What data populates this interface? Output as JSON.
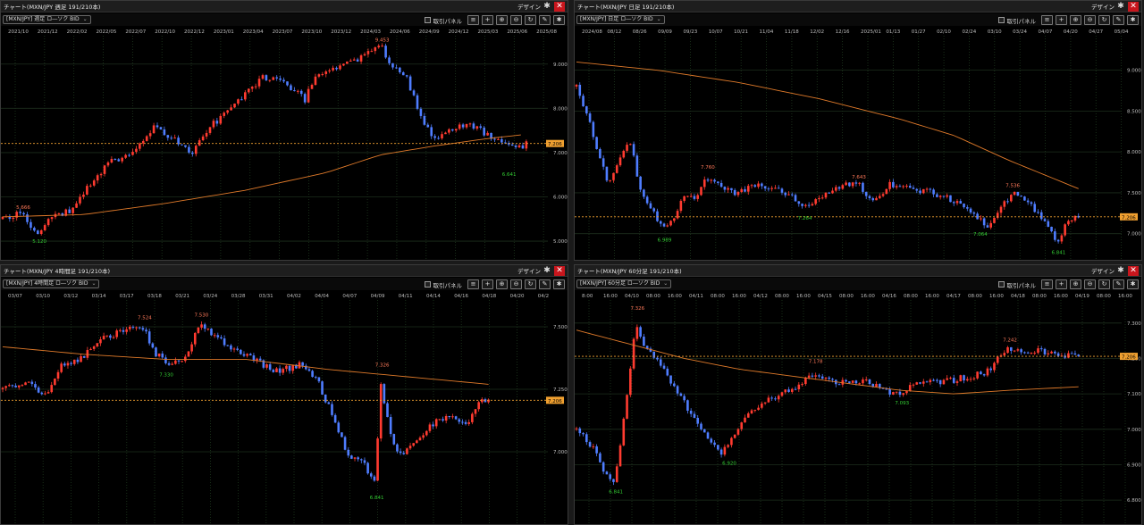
{
  "common": {
    "design_label": "デザイン",
    "close_glyph": "✕",
    "gear_glyph": "✱",
    "trade_panel_label": "取引パネル",
    "icons": [
      "menu-icon",
      "crosshair-icon",
      "zoom-in-icon",
      "zoom-out-icon",
      "refresh-icon",
      "draw-icon",
      "gear-icon"
    ],
    "icon_glyphs": [
      "≡",
      "+",
      "⊕",
      "⊖",
      "↻",
      "✎",
      "✱"
    ],
    "colors": {
      "up": "#ff3b30",
      "down": "#4f7dff",
      "ma": "#e07a2a",
      "current": "#f0a030",
      "high_label": "#ff7a5a",
      "low_label": "#33cc33",
      "grid": "#1f3a1f"
    }
  },
  "panels": [
    {
      "window_title": "チャート(MXN/JPY 週足 191/210本)",
      "symbol_select": "[MXN/JPY] 週足 ロ―ソク BID",
      "chart_data": {
        "type": "candlestick",
        "timeframe": "weekly",
        "x_tick_labels": [
          "2021/10",
          "2021/12",
          "2022/02",
          "2022/05",
          "2022/07",
          "2022/10",
          "2022/12",
          "2023/01",
          "2023/04",
          "2023/07",
          "2023/10",
          "2023/12",
          "2024/03",
          "2024/06",
          "2024/09",
          "2024/12",
          "2025/03",
          "2025/06",
          "2025/08"
        ],
        "y_tick_labels": [
          "9.000",
          "8.000",
          "7.000",
          "6.000",
          "5.000"
        ],
        "ylim": [
          4.8,
          9.6
        ],
        "current_price": "7.206",
        "annotations": [
          {
            "text": "5.666",
            "kind": "high",
            "x": 0.035,
            "y": 5.67
          },
          {
            "text": "5.120",
            "kind": "low",
            "x": 0.065,
            "y": 5.12
          },
          {
            "text": "9.453",
            "kind": "high",
            "x": 0.7,
            "y": 9.45
          },
          {
            "text": "6.641",
            "kind": "low",
            "x": 0.935,
            "y": 6.64
          }
        ],
        "path": [
          [
            0,
            5.5
          ],
          [
            0.035,
            5.66
          ],
          [
            0.065,
            5.15
          ],
          [
            0.09,
            5.55
          ],
          [
            0.13,
            5.72
          ],
          [
            0.16,
            6.25
          ],
          [
            0.2,
            6.8
          ],
          [
            0.24,
            7.0
          ],
          [
            0.28,
            7.55
          ],
          [
            0.31,
            7.35
          ],
          [
            0.35,
            7.0
          ],
          [
            0.38,
            7.55
          ],
          [
            0.42,
            7.95
          ],
          [
            0.45,
            8.35
          ],
          [
            0.48,
            8.7
          ],
          [
            0.52,
            8.6
          ],
          [
            0.56,
            8.2
          ],
          [
            0.58,
            8.75
          ],
          [
            0.62,
            8.9
          ],
          [
            0.66,
            9.1
          ],
          [
            0.7,
            9.45
          ],
          [
            0.72,
            8.9
          ],
          [
            0.745,
            8.8
          ],
          [
            0.76,
            8.3
          ],
          [
            0.775,
            7.8
          ],
          [
            0.8,
            7.3
          ],
          [
            0.83,
            7.55
          ],
          [
            0.87,
            7.6
          ],
          [
            0.9,
            7.4
          ],
          [
            0.93,
            7.25
          ],
          [
            0.95,
            7.05
          ],
          [
            0.97,
            7.2
          ]
        ],
        "ma": [
          [
            0,
            5.55
          ],
          [
            0.15,
            5.6
          ],
          [
            0.3,
            5.85
          ],
          [
            0.45,
            6.15
          ],
          [
            0.6,
            6.55
          ],
          [
            0.7,
            6.95
          ],
          [
            0.8,
            7.15
          ],
          [
            0.9,
            7.32
          ],
          [
            0.96,
            7.4
          ]
        ]
      }
    },
    {
      "window_title": "チャート(MXN/JPY 日足 191/210本)",
      "symbol_select": "[MXN/JPY] 日足 ロ―ソク BID",
      "chart_data": {
        "type": "candlestick",
        "timeframe": "daily",
        "x_tick_labels": [
          "2024/08",
          "08/12",
          "08/26",
          "09/09",
          "09/23",
          "10/07",
          "10/21",
          "11/04",
          "11/18",
          "12/02",
          "12/16",
          "2025/01",
          "01/13",
          "01/27",
          "02/10",
          "02/24",
          "03/10",
          "03/24",
          "04/07",
          "04/20",
          "04/27",
          "05/04"
        ],
        "y_tick_labels": [
          "9.000",
          "8.500",
          "8.000",
          "7.500",
          "7.000"
        ],
        "ylim": [
          6.8,
          9.4
        ],
        "current_price": "7.206",
        "annotations": [
          {
            "text": "7.760",
            "kind": "high",
            "x": 0.24,
            "y": 7.76
          },
          {
            "text": "6.989",
            "kind": "low",
            "x": 0.16,
            "y": 6.99
          },
          {
            "text": "7.643",
            "kind": "high",
            "x": 0.52,
            "y": 7.64
          },
          {
            "text": "7.264",
            "kind": "low",
            "x": 0.42,
            "y": 7.26
          },
          {
            "text": "7.536",
            "kind": "high",
            "x": 0.805,
            "y": 7.54
          },
          {
            "text": "7.064",
            "kind": "low",
            "x": 0.745,
            "y": 7.06
          },
          {
            "text": "6.841",
            "kind": "low",
            "x": 0.89,
            "y": 6.84
          }
        ],
        "path": [
          [
            0,
            8.8
          ],
          [
            0.02,
            8.45
          ],
          [
            0.04,
            8.0
          ],
          [
            0.06,
            7.6
          ],
          [
            0.08,
            7.95
          ],
          [
            0.1,
            8.1
          ],
          [
            0.12,
            7.5
          ],
          [
            0.14,
            7.3
          ],
          [
            0.16,
            7.05
          ],
          [
            0.18,
            7.2
          ],
          [
            0.2,
            7.5
          ],
          [
            0.22,
            7.4
          ],
          [
            0.24,
            7.7
          ],
          [
            0.27,
            7.55
          ],
          [
            0.3,
            7.5
          ],
          [
            0.33,
            7.6
          ],
          [
            0.36,
            7.55
          ],
          [
            0.39,
            7.5
          ],
          [
            0.42,
            7.3
          ],
          [
            0.45,
            7.45
          ],
          [
            0.48,
            7.55
          ],
          [
            0.5,
            7.6
          ],
          [
            0.52,
            7.62
          ],
          [
            0.55,
            7.4
          ],
          [
            0.58,
            7.6
          ],
          [
            0.62,
            7.55
          ],
          [
            0.66,
            7.5
          ],
          [
            0.7,
            7.4
          ],
          [
            0.73,
            7.25
          ],
          [
            0.76,
            7.1
          ],
          [
            0.79,
            7.35
          ],
          [
            0.81,
            7.5
          ],
          [
            0.84,
            7.35
          ],
          [
            0.87,
            7.1
          ],
          [
            0.89,
            6.9
          ],
          [
            0.91,
            7.15
          ],
          [
            0.93,
            7.2
          ]
        ],
        "ma": [
          [
            0,
            9.1
          ],
          [
            0.15,
            9.0
          ],
          [
            0.3,
            8.85
          ],
          [
            0.45,
            8.65
          ],
          [
            0.6,
            8.4
          ],
          [
            0.7,
            8.2
          ],
          [
            0.8,
            7.9
          ],
          [
            0.93,
            7.55
          ]
        ]
      }
    },
    {
      "window_title": "チャート(MXN/JPY 4時間足 191/210本)",
      "symbol_select": "[MXN/JPY] 4時間足 ロ―ソク BID",
      "chart_data": {
        "type": "candlestick",
        "timeframe": "4-hour",
        "x_tick_labels": [
          "03/07",
          "03/10",
          "03/12",
          "03/14",
          "03/17",
          "03/18",
          "03/21",
          "03/24",
          "03/28",
          "03/31",
          "04/02",
          "04/04",
          "04/07",
          "04/09",
          "04/11",
          "04/14",
          "04/16",
          "04/18",
          "04/20",
          "04/2"
        ],
        "y_tick_labels": [
          "7.500",
          "7.250",
          "7.000"
        ],
        "ylim": [
          6.75,
          7.6
        ],
        "current_price": "7.206",
        "annotations": [
          {
            "text": "7.524",
            "kind": "high",
            "x": 0.26,
            "y": 7.52
          },
          {
            "text": "7.530",
            "kind": "high",
            "x": 0.365,
            "y": 7.53
          },
          {
            "text": "7.330",
            "kind": "low",
            "x": 0.3,
            "y": 7.33
          },
          {
            "text": "7.326",
            "kind": "high",
            "x": 0.7,
            "y": 7.33
          },
          {
            "text": "6.841",
            "kind": "low",
            "x": 0.69,
            "y": 6.84
          }
        ],
        "path": [
          [
            0,
            7.25
          ],
          [
            0.04,
            7.28
          ],
          [
            0.08,
            7.22
          ],
          [
            0.11,
            7.35
          ],
          [
            0.15,
            7.38
          ],
          [
            0.18,
            7.45
          ],
          [
            0.22,
            7.48
          ],
          [
            0.26,
            7.5
          ],
          [
            0.28,
            7.4
          ],
          [
            0.31,
            7.35
          ],
          [
            0.34,
            7.38
          ],
          [
            0.365,
            7.52
          ],
          [
            0.4,
            7.45
          ],
          [
            0.44,
            7.4
          ],
          [
            0.48,
            7.35
          ],
          [
            0.51,
            7.32
          ],
          [
            0.55,
            7.35
          ],
          [
            0.58,
            7.3
          ],
          [
            0.6,
            7.2
          ],
          [
            0.62,
            7.1
          ],
          [
            0.64,
            6.98
          ],
          [
            0.67,
            6.95
          ],
          [
            0.69,
            6.87
          ],
          [
            0.7,
            7.28
          ],
          [
            0.72,
            7.05
          ],
          [
            0.74,
            6.98
          ],
          [
            0.77,
            7.05
          ],
          [
            0.8,
            7.12
          ],
          [
            0.83,
            7.15
          ],
          [
            0.86,
            7.1
          ],
          [
            0.88,
            7.2
          ],
          [
            0.9,
            7.21
          ]
        ],
        "ma": [
          [
            0,
            7.42
          ],
          [
            0.15,
            7.39
          ],
          [
            0.3,
            7.37
          ],
          [
            0.45,
            7.37
          ],
          [
            0.6,
            7.33
          ],
          [
            0.75,
            7.3
          ],
          [
            0.9,
            7.27
          ]
        ]
      }
    },
    {
      "window_title": "チャート(MXN/JPY 60分足 191/210本)",
      "symbol_select": "[MXN/JPY] 60分足 ロ―ソク BID",
      "chart_data": {
        "type": "candlestick",
        "timeframe": "60-minute",
        "x_tick_labels": [
          "8:00",
          "16:00",
          "04/10",
          "08:00",
          "16:00",
          "04/11",
          "08:00",
          "16:00",
          "04/12",
          "08:00",
          "16:00",
          "04/15",
          "08:00",
          "16:00",
          "04/16",
          "08:00",
          "16:00",
          "04/17",
          "08:00",
          "16:00",
          "04/18",
          "08:00",
          "16:00",
          "04/19",
          "08:00",
          "16:00"
        ],
        "y_tick_labels": [
          "7.300",
          "7.200",
          "7.100",
          "7.000",
          "6.900",
          "6.800"
        ],
        "ylim": [
          6.76,
          7.36
        ],
        "current_price": "7.206",
        "annotations": [
          {
            "text": "7.326",
            "kind": "high",
            "x": 0.11,
            "y": 7.33
          },
          {
            "text": "6.841",
            "kind": "low",
            "x": 0.07,
            "y": 6.84
          },
          {
            "text": "6.920",
            "kind": "low",
            "x": 0.28,
            "y": 6.92
          },
          {
            "text": "7.178",
            "kind": "high",
            "x": 0.44,
            "y": 7.18
          },
          {
            "text": "7.093",
            "kind": "low",
            "x": 0.6,
            "y": 7.09
          },
          {
            "text": "7.242",
            "kind": "high",
            "x": 0.8,
            "y": 7.24
          }
        ],
        "path": [
          [
            0,
            7.0
          ],
          [
            0.03,
            6.95
          ],
          [
            0.05,
            6.88
          ],
          [
            0.07,
            6.85
          ],
          [
            0.09,
            7.05
          ],
          [
            0.11,
            7.3
          ],
          [
            0.13,
            7.22
          ],
          [
            0.15,
            7.2
          ],
          [
            0.17,
            7.15
          ],
          [
            0.19,
            7.1
          ],
          [
            0.21,
            7.05
          ],
          [
            0.24,
            6.98
          ],
          [
            0.27,
            6.93
          ],
          [
            0.29,
            6.98
          ],
          [
            0.32,
            7.05
          ],
          [
            0.35,
            7.08
          ],
          [
            0.38,
            7.1
          ],
          [
            0.41,
            7.12
          ],
          [
            0.44,
            7.16
          ],
          [
            0.47,
            7.14
          ],
          [
            0.5,
            7.13
          ],
          [
            0.53,
            7.14
          ],
          [
            0.56,
            7.12
          ],
          [
            0.59,
            7.1
          ],
          [
            0.61,
            7.11
          ],
          [
            0.64,
            7.14
          ],
          [
            0.67,
            7.13
          ],
          [
            0.7,
            7.14
          ],
          [
            0.73,
            7.15
          ],
          [
            0.76,
            7.16
          ],
          [
            0.78,
            7.2
          ],
          [
            0.8,
            7.23
          ],
          [
            0.83,
            7.22
          ],
          [
            0.87,
            7.22
          ],
          [
            0.9,
            7.21
          ],
          [
            0.93,
            7.21
          ]
        ],
        "ma": [
          [
            0,
            7.28
          ],
          [
            0.1,
            7.24
          ],
          [
            0.2,
            7.2
          ],
          [
            0.3,
            7.17
          ],
          [
            0.4,
            7.15
          ],
          [
            0.5,
            7.13
          ],
          [
            0.6,
            7.11
          ],
          [
            0.7,
            7.1
          ],
          [
            0.8,
            7.11
          ],
          [
            0.93,
            7.12
          ]
        ]
      }
    }
  ]
}
